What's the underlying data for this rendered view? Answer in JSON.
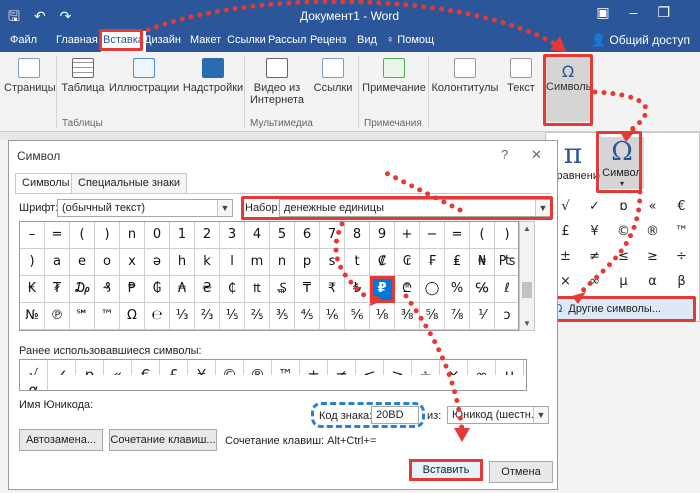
{
  "titlebar": {
    "doc_title": "Документ1 - Word",
    "qat_icons": [
      "save-icon",
      "undo-icon",
      "redo-icon"
    ],
    "window_icons": [
      "ribbon-display-icon",
      "minimize-icon",
      "restore-icon"
    ]
  },
  "tabs": [
    "Файл",
    "Главная",
    "Вставка",
    "Дизайн",
    "Макет",
    "Ссылки",
    "Рассыл",
    "Реценз",
    "Вид",
    "♀ Помощ"
  ],
  "share_label": "Общий доступ",
  "ribbon": {
    "buttons": [
      "Страницы",
      "Таблица",
      "Иллюстрации",
      "Надстройки",
      "Видео из Интернета",
      "Ссылки",
      "Примечание",
      "Колонтитулы",
      "Текст",
      "Символы"
    ],
    "groups": [
      "Таблицы",
      "Мультимедиа",
      "Примечания"
    ]
  },
  "rpanel": {
    "equation": "Уравнение",
    "symbol": "Символ",
    "symbol_glyph": "Ω",
    "pi_glyph": "π",
    "more_symbols": "Другие символы...",
    "omega_small": "Ω",
    "grid": [
      "√",
      "✓",
      "ɒ",
      "«",
      "€",
      "£",
      "¥",
      "©",
      "®",
      "™",
      "±",
      "≠",
      "≤",
      "≥",
      "÷",
      "×",
      "∞",
      "µ",
      "α",
      "β"
    ]
  },
  "dialog": {
    "title": "Символ",
    "tabs": [
      "Символы",
      "Специальные знаки"
    ],
    "font_label": "Шрифт:",
    "font_value": "(обычный текст)",
    "set_label": "Набор:",
    "set_value": "денежные единицы",
    "symbols": [
      [
        "–",
        "=",
        "(",
        ")",
        "n",
        "0",
        "1",
        "2",
        "3",
        "4",
        "5",
        "6",
        "7",
        "8",
        "9",
        "+",
        "−",
        "=",
        "(",
        ")"
      ],
      [
        ")",
        "a",
        "e",
        "o",
        "x",
        "ə",
        "h",
        "k",
        "l",
        "m",
        "n",
        "p",
        "s",
        "t",
        "₡",
        "₢",
        "₣",
        "₤",
        "₦",
        "₧"
      ],
      [
        "₭",
        "₮",
        "₯",
        "₰",
        "₱",
        "₲",
        "₳",
        "₴",
        "₵",
        "₶",
        "₷",
        "₸",
        "₹",
        "₺",
        "₽",
        "₾",
        "◯",
        "%",
        "℅",
        "ℓ"
      ],
      [
        "№",
        "℗",
        "℠",
        "™",
        "Ω",
        "℮",
        "⅓",
        "⅔",
        "⅕",
        "⅖",
        "⅗",
        "⅘",
        "⅙",
        "⅚",
        "⅛",
        "⅜",
        "⅝",
        "⅞",
        "⅟",
        "ↄ"
      ]
    ],
    "selected_symbol": "₽",
    "recent_label": "Ранее использовавшиеся символы:",
    "recent": [
      "√",
      "✓",
      "ɒ",
      "«",
      "€",
      "£",
      "¥",
      "©",
      "®",
      "™",
      "±",
      "≠",
      "≤",
      "≥",
      "÷",
      "×",
      "∞",
      "µ",
      "α"
    ],
    "unicode_name_label": "Имя Юникода:",
    "code_label": "Код знака:",
    "code_value": "20BD",
    "from_label": "из:",
    "from_value": "Юникод (шестн.)",
    "autocorrect": "Автозамена...",
    "shortcut_btn": "Сочетание клавиш...",
    "shortcut_text": "Сочетание клавиш: Alt+Ctrl+=",
    "insert": "Вставить",
    "cancel": "Отмена",
    "help_icon": "?",
    "close_icon": "✕"
  },
  "colors": {
    "accent": "#2b579a",
    "highlight": "#e53935",
    "selection": "#0078d7"
  }
}
